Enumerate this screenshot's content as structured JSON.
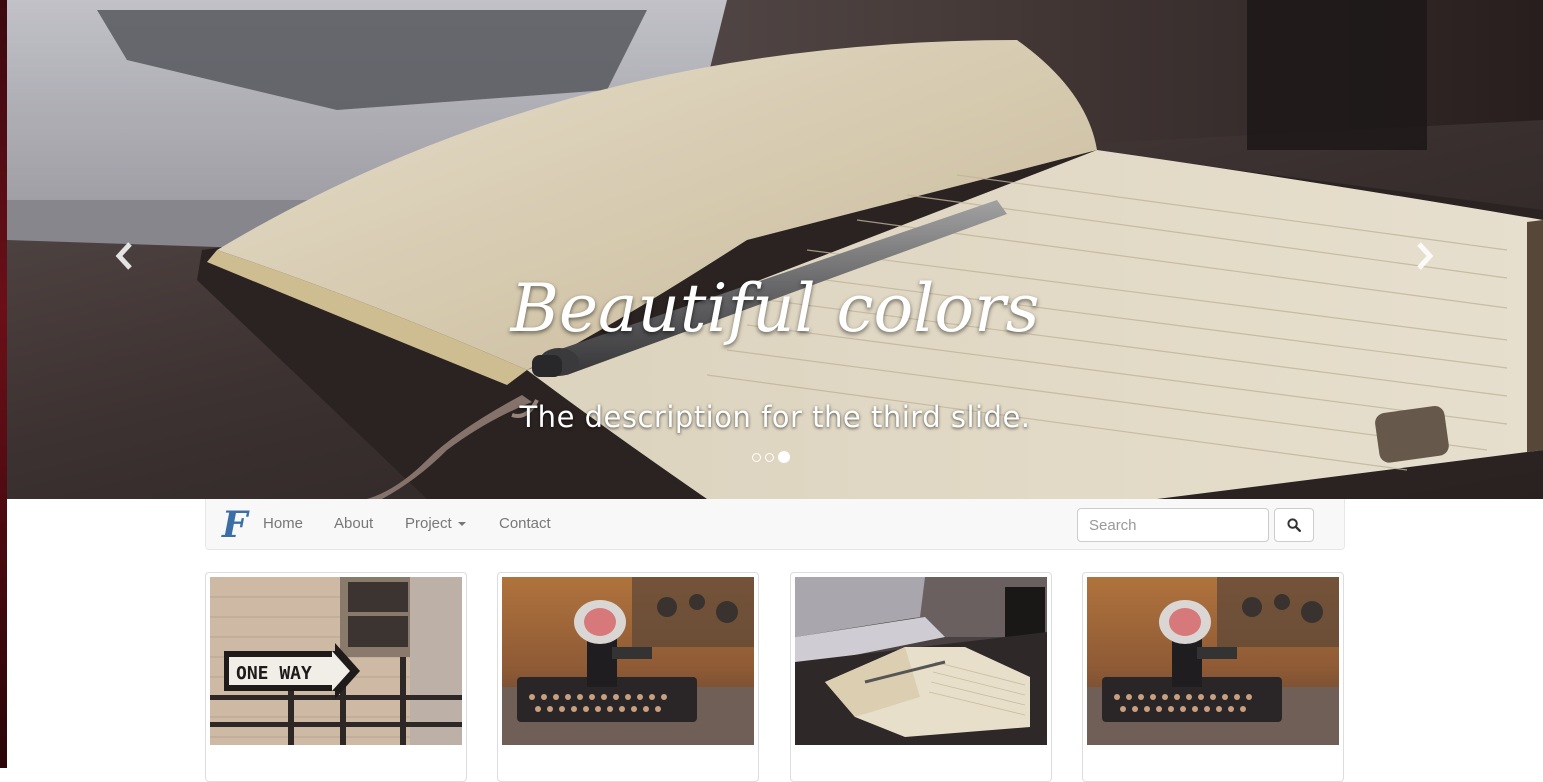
{
  "carousel": {
    "slide_title": "Beautiful colors",
    "slide_description": "The description for the third slide.",
    "slide_count": 3,
    "active_slide": 3,
    "prev_icon": "chevron-left-icon",
    "next_icon": "chevron-right-icon"
  },
  "navbar": {
    "brand_letter": "F",
    "brand_color": "#3a6ea5",
    "items": [
      {
        "label": "Home"
      },
      {
        "label": "About"
      },
      {
        "label": "Project",
        "dropdown": true
      },
      {
        "label": "Contact"
      }
    ],
    "search": {
      "placeholder": "Search",
      "value": ""
    },
    "search_icon": "search-icon"
  },
  "thumbnails": [
    {
      "subject": "one-way-sign",
      "sign_text": "ONE WAY"
    },
    {
      "subject": "vintage-typewriter"
    },
    {
      "subject": "notebook-laptop"
    },
    {
      "subject": "vintage-typewriter"
    }
  ]
}
